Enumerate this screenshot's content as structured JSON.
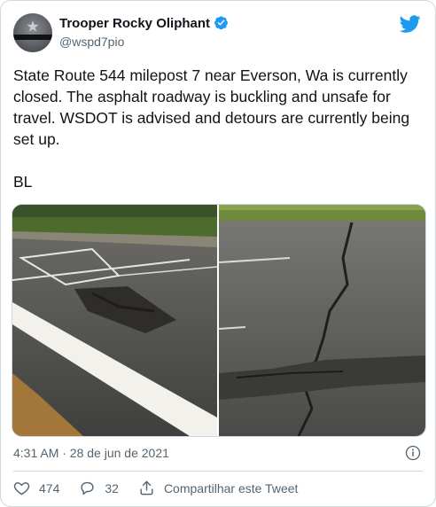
{
  "author": {
    "name": "Trooper Rocky Oliphant",
    "handle": "@wspd7pio",
    "verified": true
  },
  "tweet": {
    "text": "State Route 544 milepost 7 near Everson, Wa is currently closed. The asphalt roadway is buckling and unsafe for travel. WSDOT is advised and detours are currently being set up.\n\nBL",
    "timestamp": "4:31 AM · 28 de jun de 2021"
  },
  "actions": {
    "likes": "474",
    "replies": "32",
    "share_label": "Compartilhar este Tweet"
  },
  "colors": {
    "brand": "#1d9bf0",
    "text": "#0f1419",
    "secondary": "#536471"
  },
  "icons": [
    "bird-icon",
    "verified-icon",
    "info-icon",
    "heart-icon",
    "reply-icon",
    "share-icon"
  ]
}
